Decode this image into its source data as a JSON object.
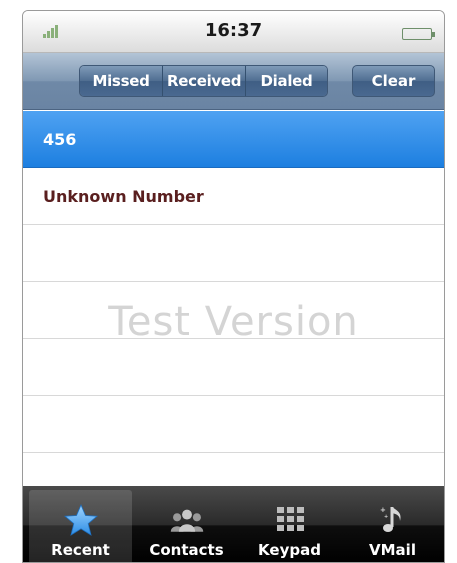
{
  "status_bar": {
    "signal_label": "..ıl",
    "time": "16:37"
  },
  "nav_bar": {
    "segments": [
      "Missed",
      "Received",
      "Dialed"
    ],
    "selected_segment": "Dialed",
    "clear_label": "Clear"
  },
  "list": {
    "items": [
      {
        "label": "456",
        "selected": true
      },
      {
        "label": "Unknown Number",
        "selected": false
      }
    ],
    "watermark": "Test Version"
  },
  "tab_bar": {
    "tabs": [
      {
        "label": "Recent",
        "icon": "star-icon",
        "active": true
      },
      {
        "label": "Contacts",
        "icon": "contacts-icon",
        "active": false
      },
      {
        "label": "Keypad",
        "icon": "keypad-icon",
        "active": false
      },
      {
        "label": "VMail",
        "icon": "voicemail-icon",
        "active": false
      }
    ]
  },
  "colors": {
    "selected_row": "#1d7fe0",
    "nav_bar": "#6f89a7",
    "tab_bar": "#000000",
    "entry_text": "#5a1f1f"
  }
}
